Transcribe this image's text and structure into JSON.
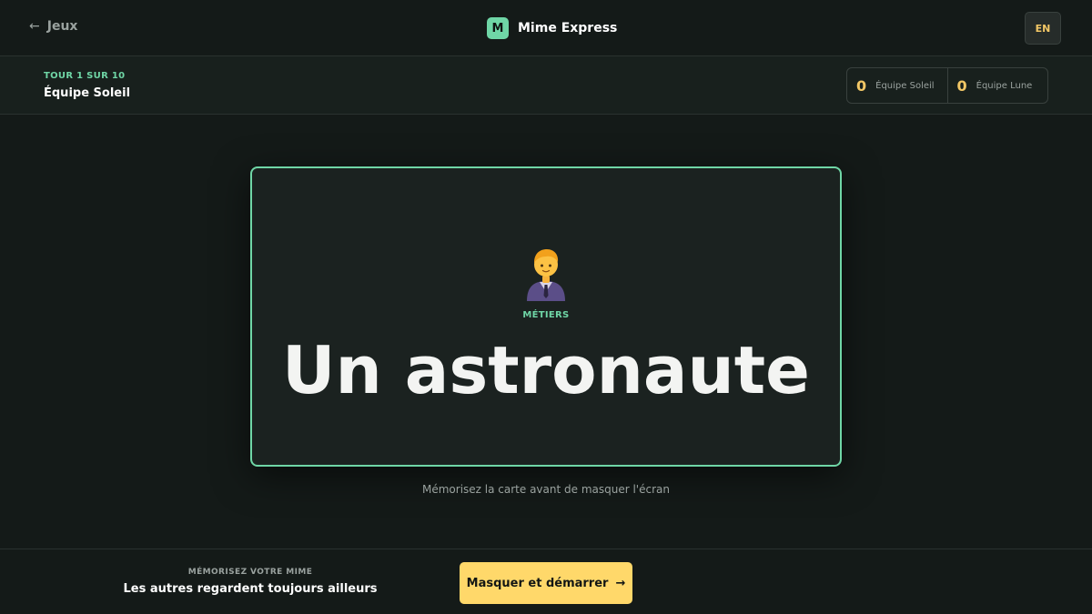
{
  "header": {
    "back_label": "Jeux",
    "back_arrow": "←",
    "brand_letter": "M",
    "brand_name": "Mime Express",
    "lang_label": "EN"
  },
  "round": {
    "label": "TOUR 1 SUR 10",
    "current_team": "Équipe Soleil"
  },
  "scores": [
    {
      "team": "Équipe Soleil",
      "points": "0"
    },
    {
      "team": "Équipe Lune",
      "points": "0"
    }
  ],
  "card": {
    "icon": "office-worker-icon",
    "category": "MÉTIERS",
    "word": "Un astronaute"
  },
  "hint": "Mémorisez la carte avant de masquer l'écran",
  "footer": {
    "kicker": "MÉMORISEZ VOTRE MIME",
    "message": "Les autres regardent toujours ailleurs",
    "button_label": "Masquer et démarrer",
    "button_arrow": "→"
  },
  "colors": {
    "accent": "#6fd6a6",
    "highlight": "#ffd86a",
    "background": "#141a18"
  }
}
